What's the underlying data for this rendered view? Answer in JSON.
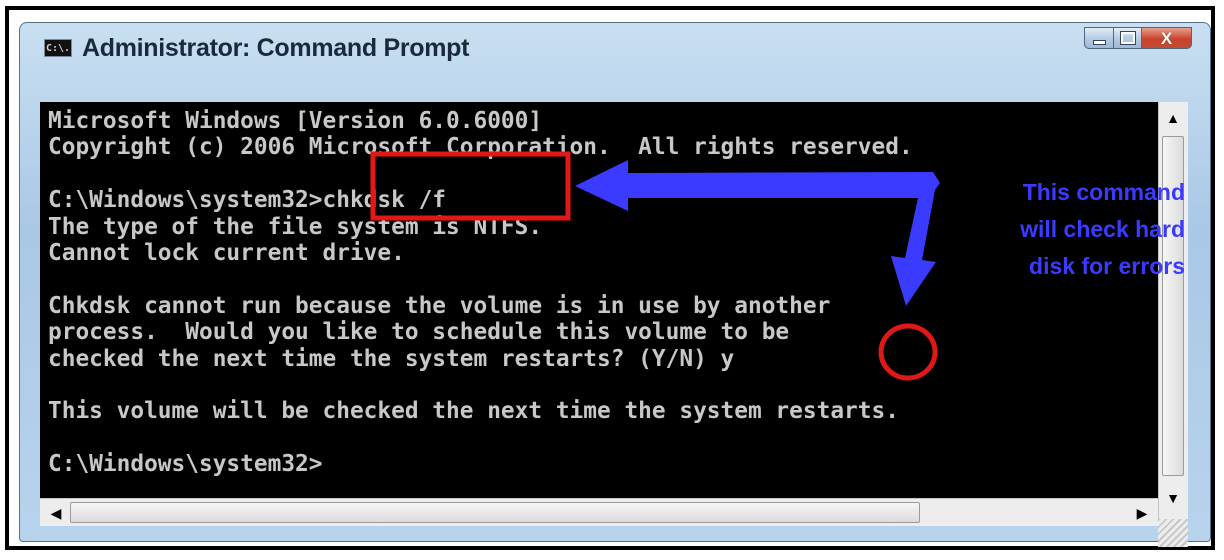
{
  "window": {
    "title": "Administrator: Command Prompt",
    "icon_label": "C:\\.",
    "buttons": {
      "minimize": "minimize-icon",
      "maximize": "maximize-icon",
      "close": "close-icon",
      "close_glyph": "X"
    }
  },
  "console": {
    "lines": [
      "Microsoft Windows [Version 6.0.6000]",
      "Copyright (c) 2006 Microsoft Corporation.  All rights reserved.",
      "",
      "C:\\Windows\\system32>chkdsk /f",
      "The type of the file system is NTFS.",
      "Cannot lock current drive.",
      "",
      "Chkdsk cannot run because the volume is in use by another",
      "process.  Would you like to schedule this volume to be",
      "checked the next time the system restarts? (Y/N) y",
      "",
      "This volume will be checked the next time the system restarts.",
      "",
      "C:\\Windows\\system32>"
    ],
    "text_color": "#c8c8c8",
    "background": "#000000"
  },
  "scrollbars": {
    "up_arrow": "▲",
    "down_arrow": "▼",
    "left_arrow": "◀",
    "right_arrow": "▶"
  },
  "annotation": {
    "callout_lines": [
      "This command",
      "will check hard",
      "disk for errors"
    ],
    "arrow_color": "#3b3bff",
    "box_color": "#e01818"
  }
}
